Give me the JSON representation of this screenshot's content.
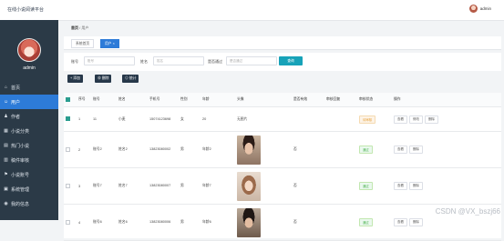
{
  "app": {
    "title": "在线小说阅读平台",
    "user": "admin"
  },
  "sidebar": {
    "profile_name": "admin",
    "items": [
      {
        "label": "首页",
        "icon": "home-icon",
        "glyph": "⌂",
        "active": false
      },
      {
        "label": "用户",
        "icon": "user-icon",
        "glyph": "☺",
        "active": true
      },
      {
        "label": "作者",
        "icon": "author-icon",
        "glyph": "♟",
        "active": false
      },
      {
        "label": "小说分类",
        "icon": "category-icon",
        "glyph": "▦",
        "active": false
      },
      {
        "label": "热门小说",
        "icon": "book-icon",
        "glyph": "▤",
        "active": false
      },
      {
        "label": "稿件审核",
        "icon": "review-icon",
        "glyph": "▥",
        "active": false
      },
      {
        "label": "小说账号",
        "icon": "flag-icon",
        "glyph": "⚑",
        "active": false
      },
      {
        "label": "系统管理",
        "icon": "settings-icon",
        "glyph": "▣",
        "active": false
      },
      {
        "label": "我的信息",
        "icon": "info-icon",
        "glyph": "◉",
        "active": false
      }
    ]
  },
  "breadcrumb": {
    "home": "首页",
    "sep": "/",
    "current": "用户"
  },
  "tabs": [
    {
      "label": "系统首页",
      "active": false
    },
    {
      "label": "用户 ×",
      "active": true
    }
  ],
  "search": {
    "field1_label": "账号",
    "field1_placeholder": "账号",
    "field2_label": "姓名",
    "field2_placeholder": "姓名",
    "field3_label": "是否通过",
    "field3_placeholder": "是否通过",
    "button": "查询"
  },
  "actions": {
    "add": "+ 添加",
    "delete": "⊗ 删除",
    "stats": "⊙ 统计"
  },
  "table": {
    "headers": [
      "",
      "序号",
      "账号",
      "姓名",
      "手机号",
      "性别",
      "年龄",
      "头像",
      "是否有效",
      "审核回复",
      "审核状态",
      "操作"
    ],
    "rows": [
      {
        "checked": true,
        "idx": "1",
        "account": "11",
        "name": "小麦",
        "phone": "15074123698",
        "gender": "女",
        "age": "20",
        "avatar_text": "无图片",
        "avatar_photo": "",
        "valid": "",
        "reply": "",
        "status": "待审核",
        "status_color": "orange",
        "ops": [
          "查看",
          "修改",
          "删除"
        ]
      },
      {
        "checked": false,
        "idx": "2",
        "account": "账号2",
        "name": "姓名2",
        "phone": "13823080002",
        "gender": "男",
        "age": "年龄2",
        "avatar_text": "",
        "avatar_photo": "man",
        "valid": "否",
        "reply": "",
        "status": "通过",
        "status_color": "green",
        "ops": [
          "查看",
          "删除"
        ]
      },
      {
        "checked": false,
        "idx": "3",
        "account": "账号7",
        "name": "姓名7",
        "phone": "13823080007",
        "gender": "男",
        "age": "年龄7",
        "avatar_text": "",
        "avatar_photo": "woman",
        "valid": "否",
        "reply": "",
        "status": "通过",
        "status_color": "green",
        "ops": [
          "查看",
          "删除"
        ]
      },
      {
        "checked": false,
        "idx": "4",
        "account": "账号6",
        "name": "姓名6",
        "phone": "13823080006",
        "gender": "男",
        "age": "年龄6",
        "avatar_text": "",
        "avatar_photo": "man2",
        "valid": "否",
        "reply": "",
        "status": "通过",
        "status_color": "green",
        "ops": [
          "查看",
          "删除"
        ]
      }
    ]
  },
  "watermark": "CSDN @VX_bszj66"
}
